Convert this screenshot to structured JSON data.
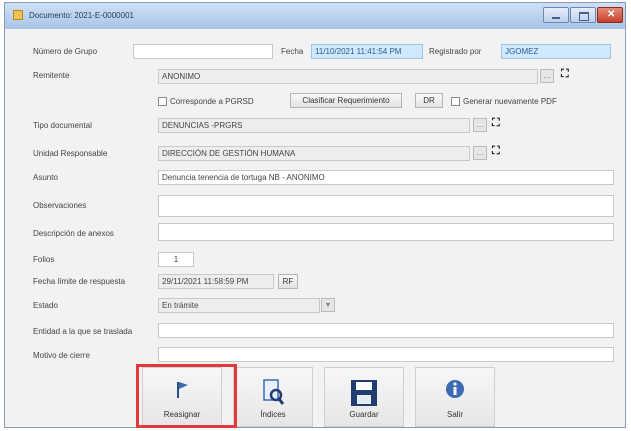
{
  "window": {
    "title": "Documento: 2021-E-0000001"
  },
  "header": {
    "numero_grupo_label": "Número de Grupo",
    "fecha_label": "Fecha",
    "fecha_value": "11/10/2021 11:41:54 PM",
    "registrado_label": "Registrado por",
    "registrado_value": "JGOMEZ"
  },
  "form": {
    "remitente_label": "Remitente",
    "remitente_value": "ANONIMO",
    "corresponde_label": "Corresponde a PGRSD",
    "clasificar_label": "Clasificar Requerimiento",
    "dr_label": "DR",
    "generar_pdf_label": "Generar nuevamente PDF",
    "tipo_doc_label": "Tipo documental",
    "tipo_doc_value": "DENUNCIAS -PRGRS",
    "unidad_label": "Unidad Responsable",
    "unidad_value": "DIRECCIÓN DE GESTIÓN HUMANA",
    "asunto_label": "Asunto",
    "asunto_value": "Denuncia tenencia de tortuga NB - ANONIMO",
    "observaciones_label": "Observaciones",
    "descripcion_anexo_label": "Descripción de anexos",
    "folios_label": "Folios",
    "folios_value": "1",
    "fecha_limite_label": "Fecha límite de respuesta",
    "fecha_limite_value": "29/11/2021 11:58:59 PM",
    "fecha_limite_btn": "RF",
    "estado_label": "Estado",
    "estado_value": "En trámite",
    "entidad_label": "Entidad a la que se traslada",
    "motivo_label": "Motivo de cierre"
  },
  "toolbar": {
    "reasignar_label": "Reasignar",
    "indices_label": "Índices",
    "guardar_label": "Guardar",
    "salir_label": "Salir"
  },
  "colors": {
    "highlight": "#e2393a",
    "date_field": "#cfe7ff",
    "title_bar": "#a9c4e8"
  }
}
